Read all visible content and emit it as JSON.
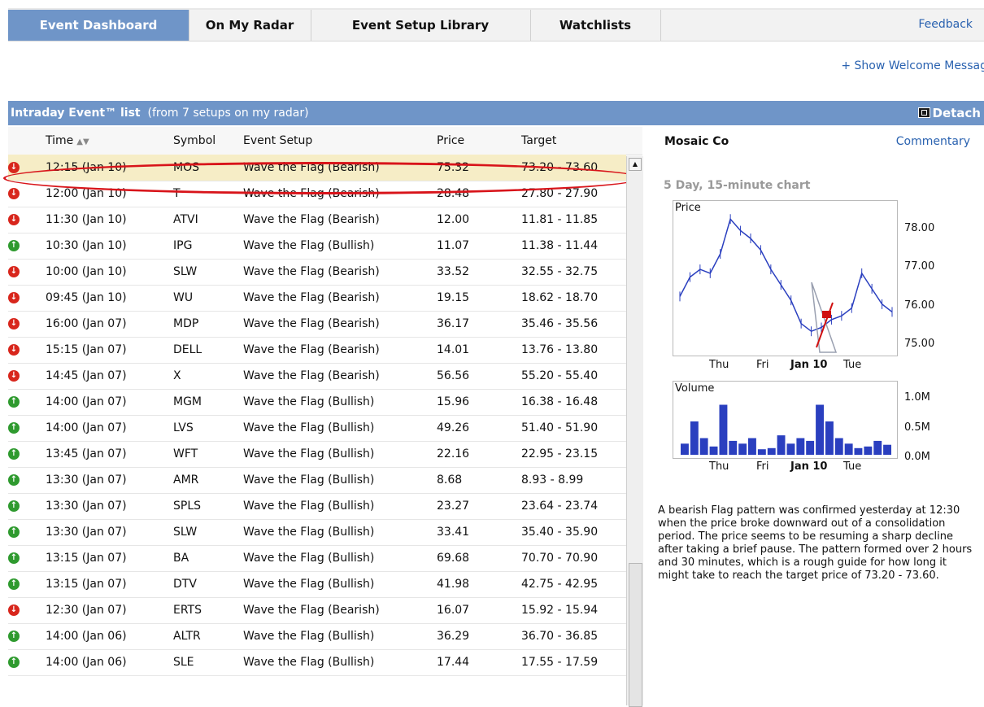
{
  "tabs": [
    {
      "label": "Event Dashboard",
      "active": true
    },
    {
      "label": "On My Radar",
      "active": false
    },
    {
      "label": "Event Setup Library",
      "active": false
    },
    {
      "label": "Watchlists",
      "active": false
    }
  ],
  "feedback_label": "Feedback",
  "welcome_link": "+ Show Welcome Messag",
  "event_list": {
    "title_bold": "Intraday Event™ list",
    "title_sub": "(from 7 setups on my radar)",
    "detach_label": "Detach",
    "columns": {
      "time": "Time",
      "symbol": "Symbol",
      "setup": "Event Setup",
      "price": "Price",
      "target": "Target"
    },
    "rows": [
      {
        "dir": "down",
        "time": "12:15 (Jan 10)",
        "symbol": "MOS",
        "setup": "Wave the Flag (Bearish)",
        "price": "75.32",
        "target": "73.20 - 73.60",
        "selected": true
      },
      {
        "dir": "down",
        "time": "12:00 (Jan 10)",
        "symbol": "T",
        "setup": "Wave the Flag (Bearish)",
        "price": "28.48",
        "target": "27.80 - 27.90"
      },
      {
        "dir": "down",
        "time": "11:30 (Jan 10)",
        "symbol": "ATVI",
        "setup": "Wave the Flag (Bearish)",
        "price": "12.00",
        "target": "11.81 - 11.85"
      },
      {
        "dir": "up",
        "time": "10:30 (Jan 10)",
        "symbol": "IPG",
        "setup": "Wave the Flag (Bullish)",
        "price": "11.07",
        "target": "11.38 - 11.44"
      },
      {
        "dir": "down",
        "time": "10:00 (Jan 10)",
        "symbol": "SLW",
        "setup": "Wave the Flag (Bearish)",
        "price": "33.52",
        "target": "32.55 - 32.75"
      },
      {
        "dir": "down",
        "time": "09:45 (Jan 10)",
        "symbol": "WU",
        "setup": "Wave the Flag (Bearish)",
        "price": "19.15",
        "target": "18.62 - 18.70"
      },
      {
        "dir": "down",
        "time": "16:00 (Jan 07)",
        "symbol": "MDP",
        "setup": "Wave the Flag (Bearish)",
        "price": "36.17",
        "target": "35.46 - 35.56"
      },
      {
        "dir": "down",
        "time": "15:15 (Jan 07)",
        "symbol": "DELL",
        "setup": "Wave the Flag (Bearish)",
        "price": "14.01",
        "target": "13.76 - 13.80"
      },
      {
        "dir": "down",
        "time": "14:45 (Jan 07)",
        "symbol": "X",
        "setup": "Wave the Flag (Bearish)",
        "price": "56.56",
        "target": "55.20 - 55.40"
      },
      {
        "dir": "up",
        "time": "14:00 (Jan 07)",
        "symbol": "MGM",
        "setup": "Wave the Flag (Bullish)",
        "price": "15.96",
        "target": "16.38 - 16.48"
      },
      {
        "dir": "up",
        "time": "14:00 (Jan 07)",
        "symbol": "LVS",
        "setup": "Wave the Flag (Bullish)",
        "price": "49.26",
        "target": "51.40 - 51.90"
      },
      {
        "dir": "up",
        "time": "13:45 (Jan 07)",
        "symbol": "WFT",
        "setup": "Wave the Flag (Bullish)",
        "price": "22.16",
        "target": "22.95 - 23.15"
      },
      {
        "dir": "up",
        "time": "13:30 (Jan 07)",
        "symbol": "AMR",
        "setup": "Wave the Flag (Bullish)",
        "price": "8.68",
        "target": "8.93 - 8.99"
      },
      {
        "dir": "up",
        "time": "13:30 (Jan 07)",
        "symbol": "SPLS",
        "setup": "Wave the Flag (Bullish)",
        "price": "23.27",
        "target": "23.64 - 23.74"
      },
      {
        "dir": "up",
        "time": "13:30 (Jan 07)",
        "symbol": "SLW",
        "setup": "Wave the Flag (Bullish)",
        "price": "33.41",
        "target": "35.40 - 35.90"
      },
      {
        "dir": "up",
        "time": "13:15 (Jan 07)",
        "symbol": "BA",
        "setup": "Wave the Flag (Bullish)",
        "price": "69.68",
        "target": "70.70 - 70.90"
      },
      {
        "dir": "up",
        "time": "13:15 (Jan 07)",
        "symbol": "DTV",
        "setup": "Wave the Flag (Bullish)",
        "price": "41.98",
        "target": "42.75 - 42.95"
      },
      {
        "dir": "down",
        "time": "12:30 (Jan 07)",
        "symbol": "ERTS",
        "setup": "Wave the Flag (Bearish)",
        "price": "16.07",
        "target": "15.92 - 15.94"
      },
      {
        "dir": "up",
        "time": "14:00 (Jan 06)",
        "symbol": "ALTR",
        "setup": "Wave the Flag (Bullish)",
        "price": "36.29",
        "target": "36.70 - 36.85"
      },
      {
        "dir": "up",
        "time": "14:00 (Jan 06)",
        "symbol": "SLE",
        "setup": "Wave the Flag (Bullish)",
        "price": "17.44",
        "target": "17.55 - 17.59"
      }
    ]
  },
  "detail": {
    "company": "Mosaic Co",
    "commentary_label": "Commentary",
    "chart_title": "5 Day, 15-minute chart",
    "price_label": "Price",
    "volume_label": "Volume",
    "price_ticks": [
      "78.00",
      "77.00",
      "76.00",
      "75.00"
    ],
    "volume_ticks": [
      "1.0M",
      "0.5M",
      "0.0M"
    ],
    "x_ticks": [
      "Thu",
      "Fri",
      "Jan 10",
      "Tue"
    ],
    "description": "A bearish Flag pattern was confirmed yesterday at 12:30 when the price broke downward out of a consolidation period. The price seems to be resuming a sharp decline after taking a brief pause. The pattern formed over 2 hours and 30 minutes, which is a rough guide for how long it might take to reach the target price of 73.20 - 73.60.",
    "colors": {
      "price_line": "#2a3fbf",
      "volume_bars": "#2a3fbf",
      "flag": "#d01010",
      "target_wedge": "#9aa0b0"
    }
  },
  "chart_data": [
    {
      "type": "line",
      "title": "5 Day, 15-minute chart",
      "ylabel": "Price",
      "x": [
        "Thu",
        "Fri",
        "Jan 10",
        "Tue"
      ],
      "ylim": [
        74.9,
        78.6
      ],
      "series": [
        {
          "values": [
            76.3,
            76.8,
            77.0,
            76.9,
            77.4,
            78.3,
            78.0,
            77.8,
            77.5,
            77.0,
            76.6,
            76.2,
            75.6,
            75.4,
            75.5,
            75.7,
            75.8,
            76.0,
            76.9,
            76.5,
            76.1,
            75.9
          ]
        }
      ]
    },
    {
      "type": "bar",
      "ylabel": "Volume",
      "x": [
        "Thu",
        "Fri",
        "Jan 10",
        "Tue"
      ],
      "ylim": [
        0,
        1.2
      ],
      "series": [
        {
          "values": [
            0.2,
            0.6,
            0.3,
            0.15,
            0.9,
            0.25,
            0.2,
            0.3,
            0.1,
            0.12,
            0.35,
            0.2,
            0.3,
            0.25,
            0.9,
            0.6,
            0.3,
            0.2,
            0.12,
            0.15,
            0.25,
            0.18
          ]
        }
      ]
    }
  ]
}
